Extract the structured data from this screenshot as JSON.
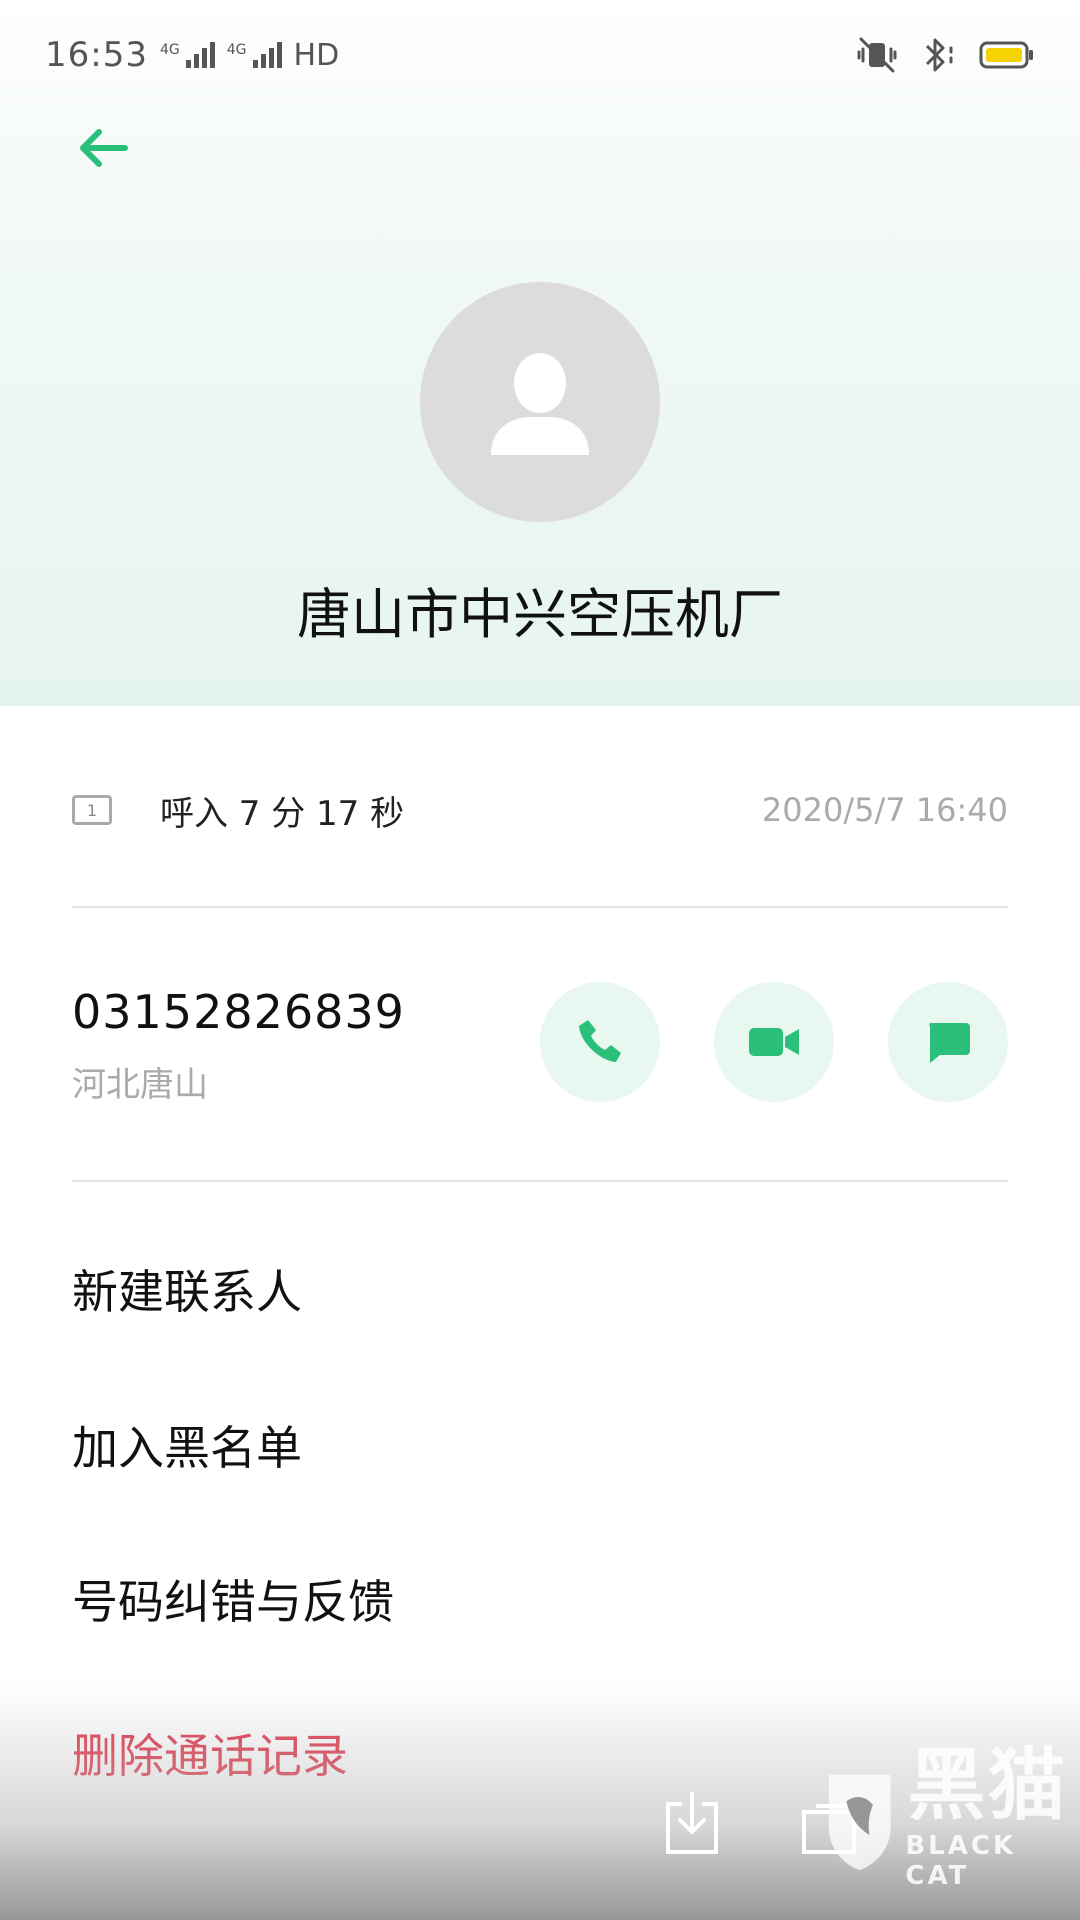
{
  "status_bar": {
    "time": "16:53",
    "network1": "4G",
    "network2": "4G",
    "hd": "HD"
  },
  "contact": {
    "name": "唐山市中兴空压机厂"
  },
  "call_log": {
    "sim": "1",
    "summary": "呼入 7 分 17 秒",
    "datetime": "2020/5/7 16:40"
  },
  "number": {
    "value": "03152826839",
    "location": "河北唐山"
  },
  "menu": {
    "new_contact": "新建联系人",
    "blacklist": "加入黑名单",
    "feedback": "号码纠错与反馈",
    "delete_log": "删除通话记录"
  },
  "watermark": {
    "cn": "黑猫",
    "en": "BLACK CAT"
  },
  "colors": {
    "accent": "#2bc07a",
    "action_bg": "#e8f7ef",
    "danger": "#e0344a"
  }
}
